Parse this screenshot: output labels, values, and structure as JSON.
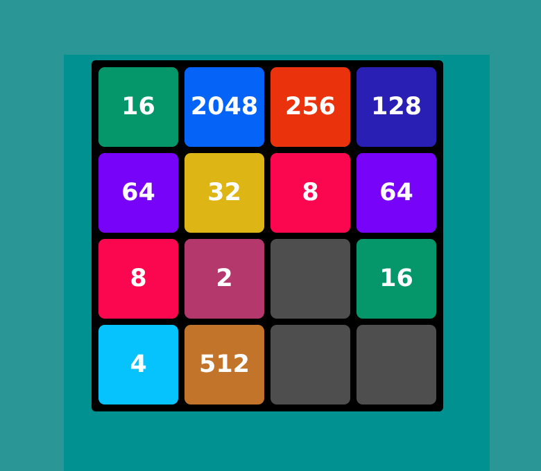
{
  "game": {
    "colors": {
      "page_background": "#2b9696",
      "panel_background": "#029191",
      "board_background": "#000000",
      "empty_tile": "#4e4e4e",
      "tile_text": "#ffffff"
    },
    "board": {
      "rows": [
        [
          {
            "value": "16",
            "color": "#05976a"
          },
          {
            "value": "2048",
            "color": "#0563f8"
          },
          {
            "value": "256",
            "color": "#ea320d"
          },
          {
            "value": "128",
            "color": "#2a1fb4"
          }
        ],
        [
          {
            "value": "64",
            "color": "#7803f9"
          },
          {
            "value": "32",
            "color": "#ddb514"
          },
          {
            "value": "8",
            "color": "#fb0750"
          },
          {
            "value": "64",
            "color": "#7803f9"
          }
        ],
        [
          {
            "value": "8",
            "color": "#fb0750"
          },
          {
            "value": "2",
            "color": "#b5386d"
          },
          {
            "value": "",
            "color": "#4e4e4e"
          },
          {
            "value": "16",
            "color": "#05976a"
          }
        ],
        [
          {
            "value": "4",
            "color": "#06c3fd"
          },
          {
            "value": "512",
            "color": "#c2742a"
          },
          {
            "value": "",
            "color": "#4e4e4e"
          },
          {
            "value": "",
            "color": "#4e4e4e"
          }
        ]
      ]
    }
  }
}
